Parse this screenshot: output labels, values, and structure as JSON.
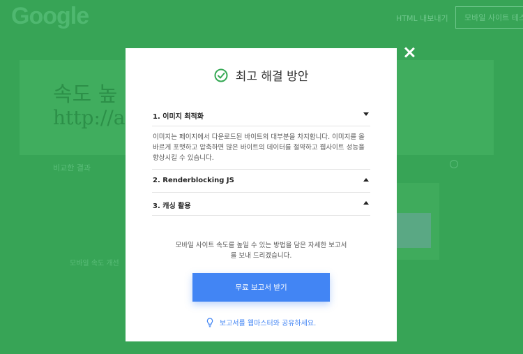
{
  "background": {
    "logo": "Google",
    "top_link": "HTML 내보내기",
    "top_button": "모바일 사이트 테스트",
    "title_partial": "속도 높",
    "url_partial": "http://a",
    "note": "비교한 결과",
    "note2": "모바일 속도 개선"
  },
  "modal": {
    "title": "최고 해결 방안",
    "close_label": "×",
    "items": [
      {
        "label": "1. 이미지 최적화",
        "expanded": true,
        "body": "이미지는 페이지에서 다운로드된 바이트의 대부분을 차지합니다. 이미지를 올바르게 포맷하고 압축하면 많은 바이트의 데이터를 절약하고 웹사이트 성능을 향상시킬 수 있습니다."
      },
      {
        "label": "2. Renderblocking JS",
        "expanded": false
      },
      {
        "label": "3. 캐싱 활용",
        "expanded": false
      }
    ],
    "description": "모바일 사이트 속도를 높일 수 있는 방법을 담은 자세한 보고서를 보내 드리겠습니다.",
    "cta_label": "무료 보고서 받기",
    "share_label": "보고서를 웹마스터와 공유하세요."
  },
  "colors": {
    "overlay_green": "#34a853",
    "accent_blue": "#4285f4",
    "check_green": "#34a853"
  },
  "icons": [
    "check-circle-icon",
    "caret-down-icon",
    "caret-up-icon",
    "close-icon",
    "lightbulb-icon"
  ]
}
